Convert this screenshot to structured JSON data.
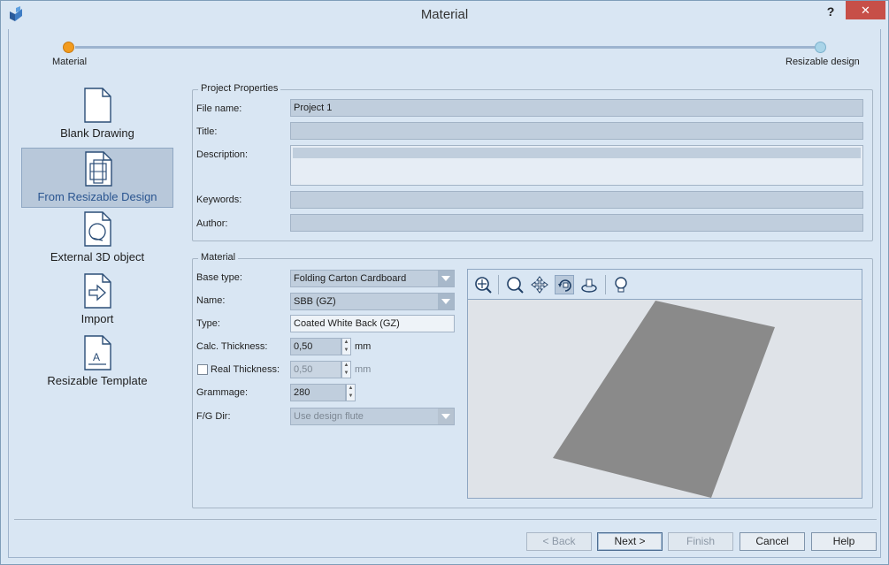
{
  "window": {
    "title": "Material",
    "help_label": "?",
    "close_label": "✕"
  },
  "progress": {
    "steps": [
      {
        "label": "Material",
        "state": "current",
        "color": "#f29b1e"
      },
      {
        "label": "Resizable design",
        "state": "pending",
        "color": "#a9d4e8"
      }
    ]
  },
  "options": [
    {
      "label": "Blank Drawing",
      "icon": "blank-page-icon",
      "selected": false
    },
    {
      "label": "From Resizable Design",
      "icon": "resizable-box-icon",
      "selected": true
    },
    {
      "label": "External 3D object",
      "icon": "external-3d-icon",
      "selected": false
    },
    {
      "label": "Import",
      "icon": "import-arrow-icon",
      "selected": false
    },
    {
      "label": "Resizable Template",
      "icon": "template-icon",
      "selected": false
    }
  ],
  "project": {
    "group_title": "Project Properties",
    "file_name_label": "File name:",
    "file_name": "Project 1",
    "title_label": "Title:",
    "title": "",
    "description_label": "Description:",
    "description": "",
    "keywords_label": "Keywords:",
    "keywords": "",
    "author_label": "Author:",
    "author": ""
  },
  "material": {
    "group_title": "Material",
    "base_type_label": "Base type:",
    "base_type": "Folding Carton Cardboard",
    "name_label": "Name:",
    "name": "SBB (GZ)",
    "type_label": "Type:",
    "type": "Coated White Back (GZ)",
    "calc_thickness_label": "Calc. Thickness:",
    "calc_thickness": "0,50",
    "calc_unit": "mm",
    "real_thickness_label": "Real Thickness:",
    "real_thickness_checked": false,
    "real_thickness": "0,50",
    "real_unit": "mm",
    "grammage_label": "Grammage:",
    "grammage": "280",
    "fg_dir_label": "F/G Dir:",
    "fg_dir": "Use design flute"
  },
  "viewer": {
    "tools": [
      "zoom-fit-icon",
      "zoom-icon",
      "pan-icon",
      "rotate-icon",
      "orbit-icon",
      "light-icon"
    ],
    "pressed_tool": "rotate-icon",
    "sheet_color": "#8a8a8a",
    "background_color": "#dfe3e8"
  },
  "buttons": {
    "back": "< Back",
    "next": "Next >",
    "finish": "Finish",
    "cancel": "Cancel",
    "help": "Help"
  }
}
